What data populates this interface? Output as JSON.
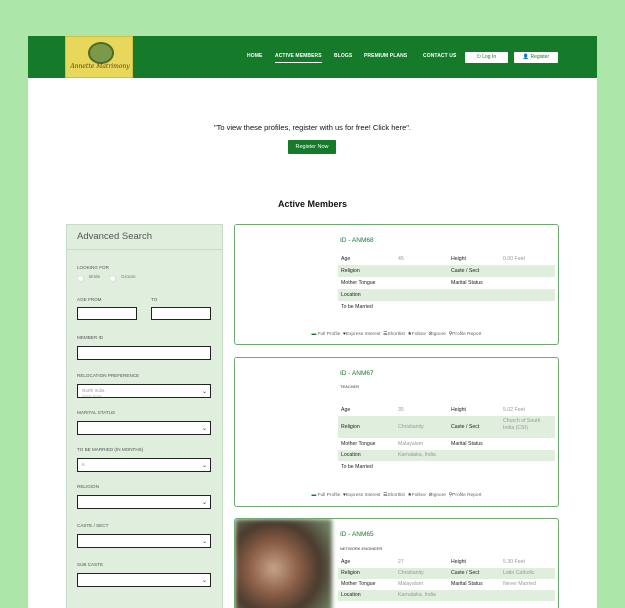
{
  "brand": {
    "name": "Annette Matrimony"
  },
  "nav": {
    "items": [
      "HOME",
      "ACTIVE MEMBERS",
      "BLOGS",
      "PREMIUM PLANS",
      "CONTACT US"
    ],
    "login": "Log In",
    "register": "Register",
    "color": "#157a2a"
  },
  "notice": "\"To view these profiles, register with us for free! Click here\".",
  "register_now": "Register Now",
  "section_title": "Active Members",
  "search": {
    "title": "Advanced Search",
    "looking_for": "LOOKING FOR",
    "bride": "Bride",
    "groom": "Groom",
    "age_from": "AGE FROM",
    "to": "TO",
    "member_id": "MEMBER ID",
    "relocation": "RELOCATION PREFERENCE",
    "relocation_value": "North India",
    "relocation_sub": "North India",
    "marital_status": "MARITAL STATUS",
    "to_be_married": "TO BE MARRIED (IN MONTHS)",
    "to_be_married_value": "6",
    "religion": "RELIGION",
    "caste": "CASTE / SECT",
    "sub_caste": "SUB CASTE"
  },
  "labels": {
    "age": "Age",
    "height": "Height",
    "religion": "Religion",
    "caste": "Caste / Sect",
    "mother_tongue": "Mother Tongue",
    "marital_status": "Marital Status",
    "location": "Location",
    "to_be_married": "To be Married"
  },
  "actions": {
    "full_profile": "Full Profile",
    "express_interest": "Express Interest",
    "shortlist": "Shortlist",
    "follow": "Follow",
    "ignore": "Ignore",
    "profile_report": "Profile Report"
  },
  "members": [
    {
      "id": "ID - ANM68",
      "occupation": "",
      "age": "45",
      "height": "0.00 Feet",
      "religion": "",
      "caste": "",
      "mother_tongue": "",
      "marital_status": "",
      "location": "",
      "to_be_married": ""
    },
    {
      "id": "ID - ANM67",
      "occupation": "TEACHER",
      "age": "35",
      "height": "5.02 Feet",
      "religion": "Christianity",
      "caste": "Church of South India (CSI)",
      "mother_tongue": "Malayalam",
      "marital_status": "",
      "location": "Karnataka, India",
      "to_be_married": ""
    },
    {
      "id": "ID - ANM65",
      "occupation": "NETWORK ENGINEER",
      "age": "27",
      "height": "5.30 Feet",
      "religion": "Christianity",
      "caste": "Latin Catholic",
      "mother_tongue": "Malayalam",
      "marital_status": "Never Married",
      "location": "Karnataka, India"
    }
  ]
}
